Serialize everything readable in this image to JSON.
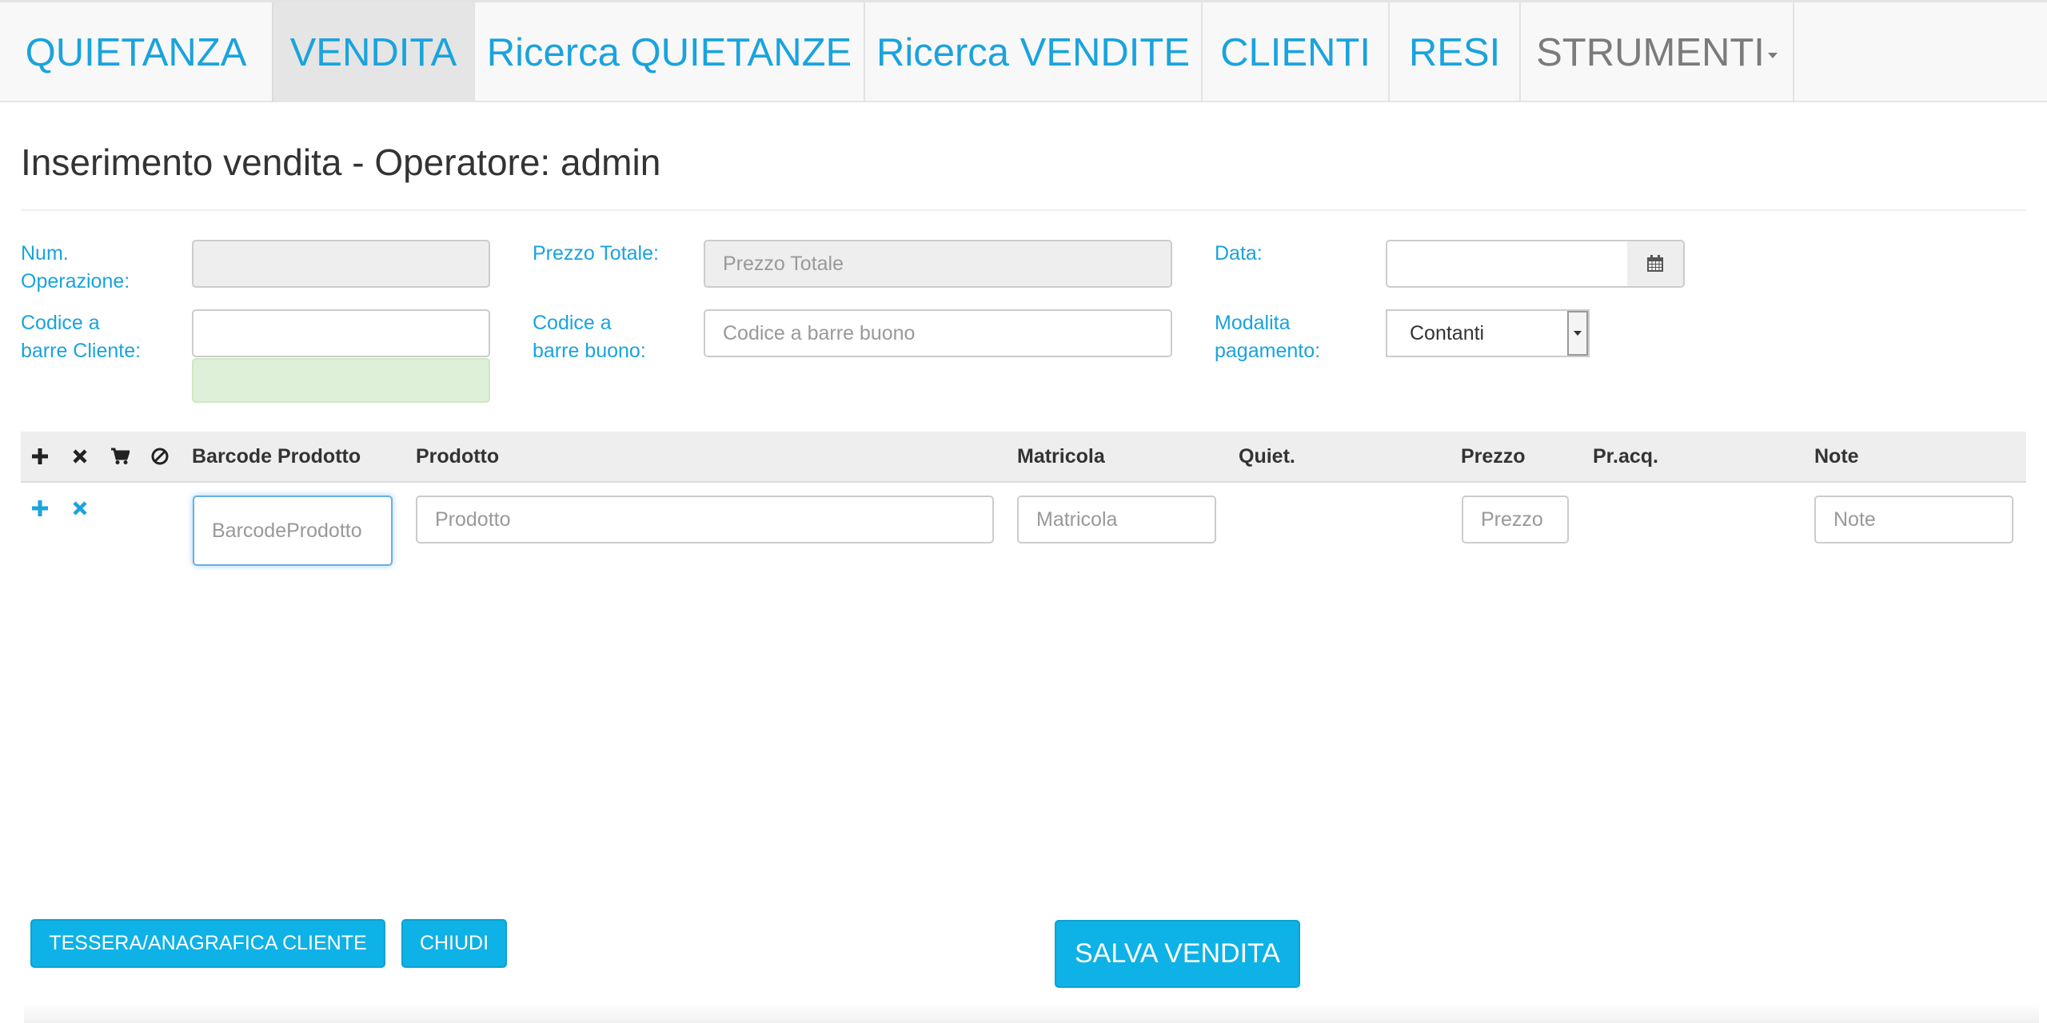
{
  "nav": {
    "items": [
      {
        "label": "QUIETANZA"
      },
      {
        "label": "VENDITA"
      },
      {
        "label": "Ricerca QUIETANZE"
      },
      {
        "label": "Ricerca VENDITE"
      },
      {
        "label": "CLIENTI"
      },
      {
        "label": "RESI"
      },
      {
        "label": "STRUMENTI"
      }
    ]
  },
  "page": {
    "title": "Inserimento vendita - Operatore: admin"
  },
  "form": {
    "num_operazione": {
      "label_1": "Num.",
      "label_2": "Operazione:",
      "value": ""
    },
    "prezzo_totale": {
      "label": "Prezzo Totale:",
      "placeholder": "Prezzo Totale"
    },
    "data": {
      "label": "Data:",
      "value": ""
    },
    "codice_cliente": {
      "label_1": "Codice a",
      "label_2": "barre Cliente:",
      "value": ""
    },
    "codice_buono": {
      "label_1": "Codice a",
      "label_2": "barre buono:",
      "placeholder": "Codice a barre buono"
    },
    "modalita": {
      "label_1": "Modalita",
      "label_2": "pagamento:",
      "selected": "Contanti"
    }
  },
  "table": {
    "headers": {
      "barcode": "Barcode Prodotto",
      "prodotto": "Prodotto",
      "matricola": "Matricola",
      "quiet": "Quiet.",
      "prezzo": "Prezzo",
      "pracq": "Pr.acq.",
      "note": "Note"
    },
    "row": {
      "barcode_placeholder": "BarcodeProdotto",
      "prodotto_placeholder": "Prodotto",
      "matricola_placeholder": "Matricola",
      "prezzo_placeholder": "Prezzo",
      "note_placeholder": "Note"
    }
  },
  "buttons": {
    "tessera": "TESSERA/ANAGRAFICA CLIENTE",
    "chiudi": "CHIUDI",
    "salva": "SALVA VENDITA"
  },
  "colors": {
    "accent": "#1aa3dd",
    "button": "#0eb2e6"
  },
  "icons": [
    "plus-icon",
    "close-icon",
    "cart-icon",
    "ban-icon",
    "calendar-icon",
    "caret-down-icon"
  ]
}
